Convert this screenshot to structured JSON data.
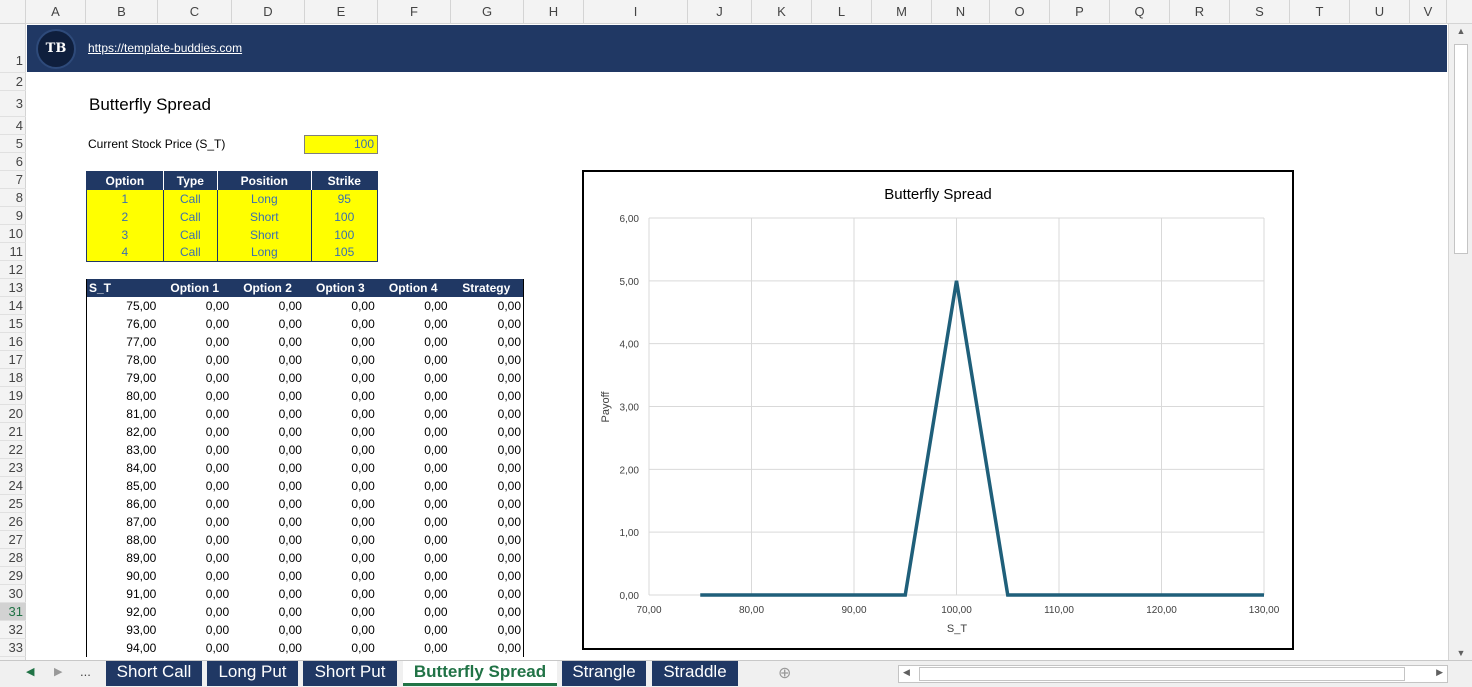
{
  "columns": [
    "A",
    "B",
    "C",
    "D",
    "E",
    "F",
    "G",
    "H",
    "I",
    "J",
    "K",
    "L",
    "M",
    "N",
    "O",
    "P",
    "Q",
    "R",
    "S",
    "T",
    "U",
    "V"
  ],
  "rows": [
    "1",
    "2",
    "3",
    "4",
    "5",
    "6",
    "7",
    "8",
    "9",
    "10",
    "11",
    "12",
    "13",
    "14",
    "15",
    "16",
    "17",
    "18",
    "19",
    "20",
    "21",
    "22",
    "23",
    "24",
    "25",
    "26",
    "27",
    "28",
    "29",
    "30",
    "31",
    "32",
    "33"
  ],
  "selected_row": "31",
  "logo_text": "TB",
  "link_text": "https://template-buddies.com",
  "title": "Butterfly Spread",
  "price_label": "Current Stock Price (S_T)",
  "price_value": "100",
  "options_table": {
    "headers": [
      "Option",
      "Type",
      "Position",
      "Strike"
    ],
    "rows": [
      [
        "1",
        "Call",
        "Long",
        "95"
      ],
      [
        "2",
        "Call",
        "Short",
        "100"
      ],
      [
        "3",
        "Call",
        "Short",
        "100"
      ],
      [
        "4",
        "Call",
        "Long",
        "105"
      ]
    ]
  },
  "payoff_table": {
    "headers": [
      "S_T",
      "Option 1",
      "Option 2",
      "Option 3",
      "Option 4",
      "Strategy"
    ],
    "rows": [
      [
        "75,00",
        "0,00",
        "0,00",
        "0,00",
        "0,00",
        "0,00"
      ],
      [
        "76,00",
        "0,00",
        "0,00",
        "0,00",
        "0,00",
        "0,00"
      ],
      [
        "77,00",
        "0,00",
        "0,00",
        "0,00",
        "0,00",
        "0,00"
      ],
      [
        "78,00",
        "0,00",
        "0,00",
        "0,00",
        "0,00",
        "0,00"
      ],
      [
        "79,00",
        "0,00",
        "0,00",
        "0,00",
        "0,00",
        "0,00"
      ],
      [
        "80,00",
        "0,00",
        "0,00",
        "0,00",
        "0,00",
        "0,00"
      ],
      [
        "81,00",
        "0,00",
        "0,00",
        "0,00",
        "0,00",
        "0,00"
      ],
      [
        "82,00",
        "0,00",
        "0,00",
        "0,00",
        "0,00",
        "0,00"
      ],
      [
        "83,00",
        "0,00",
        "0,00",
        "0,00",
        "0,00",
        "0,00"
      ],
      [
        "84,00",
        "0,00",
        "0,00",
        "0,00",
        "0,00",
        "0,00"
      ],
      [
        "85,00",
        "0,00",
        "0,00",
        "0,00",
        "0,00",
        "0,00"
      ],
      [
        "86,00",
        "0,00",
        "0,00",
        "0,00",
        "0,00",
        "0,00"
      ],
      [
        "87,00",
        "0,00",
        "0,00",
        "0,00",
        "0,00",
        "0,00"
      ],
      [
        "88,00",
        "0,00",
        "0,00",
        "0,00",
        "0,00",
        "0,00"
      ],
      [
        "89,00",
        "0,00",
        "0,00",
        "0,00",
        "0,00",
        "0,00"
      ],
      [
        "90,00",
        "0,00",
        "0,00",
        "0,00",
        "0,00",
        "0,00"
      ],
      [
        "91,00",
        "0,00",
        "0,00",
        "0,00",
        "0,00",
        "0,00"
      ],
      [
        "92,00",
        "0,00",
        "0,00",
        "0,00",
        "0,00",
        "0,00"
      ],
      [
        "93,00",
        "0,00",
        "0,00",
        "0,00",
        "0,00",
        "0,00"
      ],
      [
        "94,00",
        "0,00",
        "0,00",
        "0,00",
        "0,00",
        "0,00"
      ]
    ]
  },
  "chart_data": {
    "type": "line",
    "title": "Butterfly Spread",
    "xlabel": "S_T",
    "ylabel": "Payoff",
    "xlim": [
      70,
      130
    ],
    "ylim": [
      0,
      6
    ],
    "x_ticks": [
      "70,00",
      "80,00",
      "90,00",
      "100,00",
      "110,00",
      "120,00",
      "130,00"
    ],
    "y_ticks": [
      "0,00",
      "1,00",
      "2,00",
      "3,00",
      "4,00",
      "5,00",
      "6,00"
    ],
    "grid": true,
    "color": "#1f5f7a",
    "series": [
      {
        "x": [
          75,
          95,
          100,
          105,
          130
        ],
        "y": [
          0,
          0,
          5,
          0,
          0
        ]
      }
    ]
  },
  "sheet_tabs": [
    {
      "label": "Short Call",
      "active": false
    },
    {
      "label": "Long Put",
      "active": false
    },
    {
      "label": "Short Put",
      "active": false
    },
    {
      "label": "Butterfly Spread",
      "active": true
    },
    {
      "label": "Strangle",
      "active": false
    },
    {
      "label": "Straddle",
      "active": false
    }
  ],
  "nav": {
    "prev": "◀",
    "next": "▶",
    "more": "...",
    "add": "⊕",
    "scroll_left": "◀",
    "scroll_right": "▶",
    "scroll_up": "▲",
    "scroll_down": "▼"
  }
}
